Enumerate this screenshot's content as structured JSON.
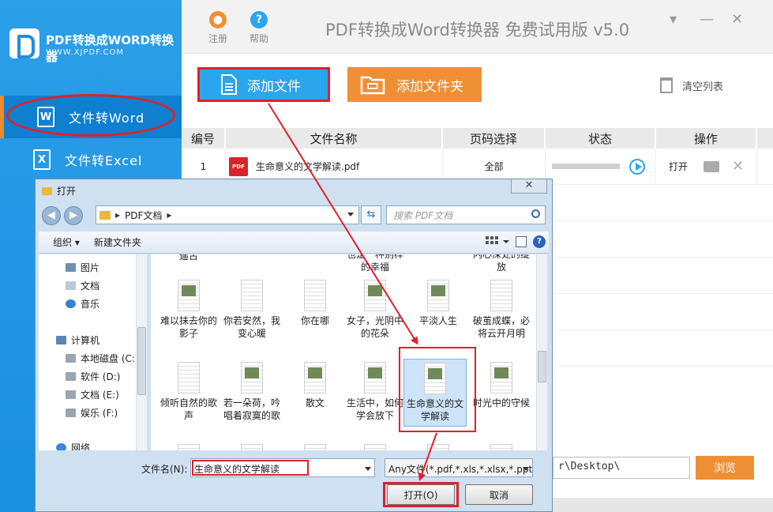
{
  "app": {
    "logo_title": "PDF转换成WORD转换器",
    "logo_sub": "WWW.XJPDF.COM",
    "title": "PDF转换成Word转换器 免费试用版 v5.0",
    "register_label": "注册",
    "help_label": "帮助",
    "nav": [
      {
        "label": "文件转Word",
        "icon": "W"
      },
      {
        "label": "文件转Excel",
        "icon": "X"
      }
    ],
    "add_file_label": "添加文件",
    "add_folder_label": "添加文件夹",
    "clear_list_label": "清空列表",
    "table": {
      "headers": [
        "编号",
        "文件名称",
        "页码选择",
        "状态",
        "操作"
      ],
      "rows": [
        {
          "num": "1",
          "name": "生命意义的文学解读.pdf",
          "pages": "全部",
          "action": "打开"
        }
      ]
    },
    "output_path": "r\\Desktop\\",
    "browse_label": "浏览"
  },
  "dialog": {
    "title": "打开",
    "address": "PDF文档",
    "search_placeholder": "搜索 PDF文档",
    "organize_label": "组织 ▾",
    "new_folder_label": "新建文件夹",
    "tree": [
      "图片",
      "文档",
      "音乐",
      "计算机",
      "本地磁盘 (C:",
      "软件 (D:)",
      "文档 (E:)",
      "娱乐 (F:)",
      "网络"
    ],
    "partial_top": [
      "遥古",
      "也是一种别样的幸福",
      "",
      "",
      "",
      "内心深处的绽放"
    ],
    "files_row1": [
      "难以抹去你的影子",
      "你若安然，我变心暖",
      "你在哪",
      "女子，光阴中的花朵",
      "平淡人生",
      "破茧成蝶，必将云开月明"
    ],
    "files_row2": [
      "倾听自然的歌声",
      "若一朵荷，吟唱着寂寞的歌",
      "散文",
      "生活中，如何学会放下",
      "生命意义的文学解读",
      "时光中的守候"
    ],
    "filename_label": "文件名(N):",
    "filename_value": "生命意义的文学解读",
    "filetype_value": "Any文件(*.pdf,*.xls,*.xlsx,*.ppt",
    "open_label": "打开(O)",
    "cancel_label": "取消"
  },
  "colors": {
    "accent_blue": "#2ba5ee",
    "accent_orange": "#ef8f34",
    "highlight_red": "#e0202a"
  }
}
